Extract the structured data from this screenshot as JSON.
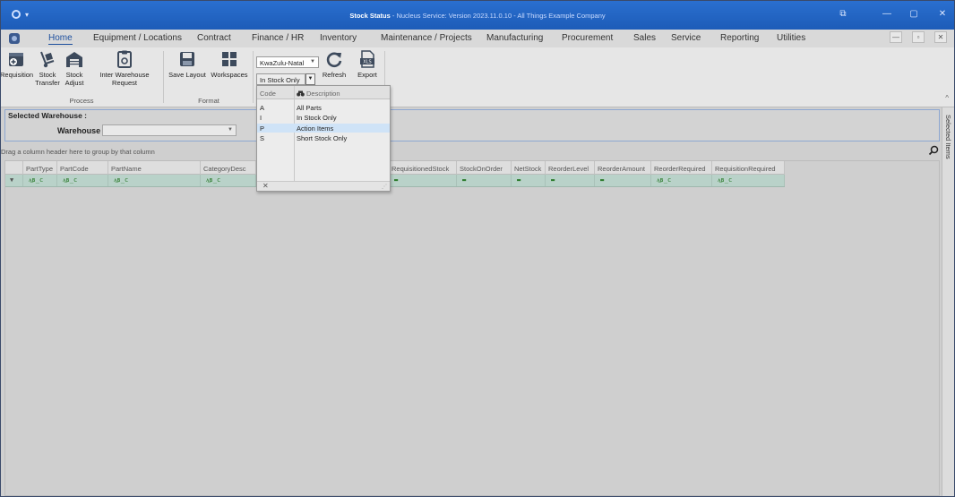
{
  "window": {
    "title_app": "Stock Status",
    "title_rest": " - Nucleus Service: Version 2023.11.0.10 - All Things Example Company",
    "quick_access": "▾",
    "btn_restore": "⧉",
    "btn_min": "—",
    "btn_max": "▢",
    "btn_close": "✕"
  },
  "tabs": [
    "Home",
    "Equipment / Locations",
    "Contract",
    "Finance / HR",
    "Inventory",
    "Maintenance / Projects",
    "Manufacturing",
    "Procurement",
    "Sales",
    "Service",
    "Reporting",
    "Utilities"
  ],
  "mdi": {
    "min": "—",
    "restore": "▫",
    "close": "✕"
  },
  "ribbon": {
    "requisition": "Requisition",
    "stock_transfer": "Stock Transfer",
    "stock_adjust": "Stock Adjust",
    "inter_warehouse": "Inter Warehouse Request",
    "save_layout": "Save Layout",
    "workspaces": "Workspaces",
    "group_process": "Process",
    "group_format": "Format",
    "region_value": "KwaZulu-Natal",
    "stock_filter_value": "In Stock Only",
    "refresh": "Refresh",
    "export": "Export",
    "collapse": "^"
  },
  "warehouse_panel": {
    "legend": "Selected Warehouse :",
    "label": "Warehouse",
    "value": ""
  },
  "side_panel": {
    "label": "Selected Items"
  },
  "grid": {
    "group_hint": "Drag a column header here to group by that column",
    "columns": [
      "PartType",
      "PartCode",
      "PartName",
      "CategoryDesc",
      "RequisitionedStock",
      "StockOnOrder",
      "NetStock",
      "ReorderLevel",
      "ReorderAmount",
      "ReorderRequired",
      "RequisitionRequired"
    ],
    "filter_symbol": "ᴀ̲ʙ̲c",
    "filter_dash": "▬"
  },
  "dropdown": {
    "col_code": "Code",
    "col_desc": "Description",
    "rows": [
      {
        "code": "A",
        "desc": "All Parts"
      },
      {
        "code": "I",
        "desc": "In Stock Only"
      },
      {
        "code": "P",
        "desc": "Action Items"
      },
      {
        "code": "S",
        "desc": "Short Stock Only"
      }
    ],
    "close": "✕"
  }
}
